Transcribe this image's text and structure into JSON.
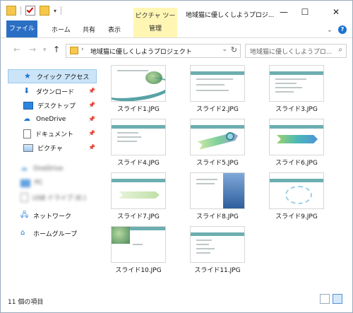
{
  "window": {
    "picture_tools_label": "ピクチャ ツール",
    "title": "地域猫に優しくしようプロジ...",
    "controls": {
      "minimize": "—",
      "maximize": "☐",
      "close": "✕"
    }
  },
  "ribbon": {
    "file": "ファイル",
    "home": "ホーム",
    "share": "共有",
    "view": "表示",
    "manage": "管理"
  },
  "address": {
    "path": "地域猫に優しくしようプロジェクト",
    "search_placeholder": "地域猫に優しくしようプロ..."
  },
  "sidebar": {
    "items": [
      {
        "label": "クイック アクセス",
        "icon": "star-icon",
        "pinned": false
      },
      {
        "label": "ダウンロード",
        "icon": "download-icon",
        "pinned": true
      },
      {
        "label": "デスクトップ",
        "icon": "desktop-icon",
        "pinned": true
      },
      {
        "label": "OneDrive",
        "icon": "cloud-icon",
        "pinned": true
      },
      {
        "label": "ドキュメント",
        "icon": "document-icon",
        "pinned": true
      },
      {
        "label": "ピクチャ",
        "icon": "picture-icon",
        "pinned": true
      },
      {
        "label": "OneDrive",
        "icon": "cloud-icon",
        "blurred": true
      },
      {
        "label": "PC",
        "icon": "pc-icon",
        "blurred": true
      },
      {
        "label": "USB ドライブ (E:)",
        "icon": "usb-icon",
        "blurred": true
      },
      {
        "label": "ネットワーク",
        "icon": "network-icon"
      },
      {
        "label": "ホームグループ",
        "icon": "homegroup-icon"
      }
    ]
  },
  "files": [
    {
      "name": "スライド1.JPG",
      "kind": "title"
    },
    {
      "name": "スライド2.JPG",
      "kind": "text"
    },
    {
      "name": "スライド3.JPG",
      "kind": "text"
    },
    {
      "name": "スライド4.JPG",
      "kind": "text"
    },
    {
      "name": "スライド5.JPG",
      "kind": "curve"
    },
    {
      "name": "スライド6.JPG",
      "kind": "arrows"
    },
    {
      "name": "スライド7.JPG",
      "kind": "steps"
    },
    {
      "name": "スライド8.JPG",
      "kind": "building"
    },
    {
      "name": "スライド9.JPG",
      "kind": "cycle"
    },
    {
      "name": "スライド10.JPG",
      "kind": "photo"
    },
    {
      "name": "スライド11.JPG",
      "kind": "text"
    }
  ],
  "status": {
    "count": "11 個の項目"
  },
  "colors": {
    "accent_blue": "#2b6fc4",
    "picture_tools_yellow": "#fff6b4",
    "selection_blue": "#cce4f7"
  }
}
